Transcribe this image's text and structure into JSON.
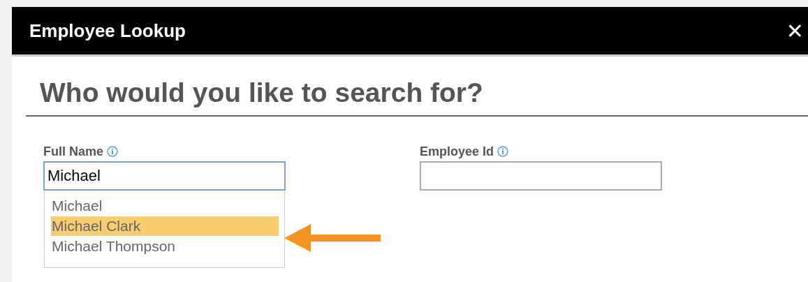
{
  "window": {
    "title": "Employee Lookup",
    "close": "✕"
  },
  "heading": "Who would you like to search for?",
  "fields": [
    {
      "label": "Full Name",
      "value": "Michael",
      "focused": true,
      "suggestions": [
        {
          "label": "Michael",
          "highlighted": false
        },
        {
          "label": "Michael Clark",
          "highlighted": true
        },
        {
          "label": "Michael Thompson",
          "highlighted": false
        }
      ]
    },
    {
      "label": "Employee Id",
      "focused": false
    }
  ]
}
